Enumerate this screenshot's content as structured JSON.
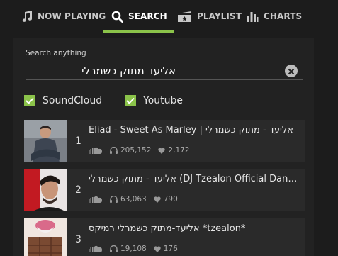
{
  "nav": {
    "tabs": [
      {
        "label": "NOW PLAYING",
        "icon": "music-note-icon"
      },
      {
        "label": "SEARCH",
        "icon": "search-icon",
        "active": true
      },
      {
        "label": "PLAYLIST",
        "icon": "playlist-icon"
      },
      {
        "label": "CHARTS",
        "icon": "bar-chart-icon"
      }
    ]
  },
  "colors": {
    "accent": "#8bc34a",
    "background": "#1c1c1c",
    "panel": "#222222",
    "row": "#2a2a2a"
  },
  "search": {
    "label": "Search anything",
    "value": "אליעד מתוק כשמרלי"
  },
  "sources": [
    {
      "label": "SoundCloud",
      "checked": true
    },
    {
      "label": "Youtube",
      "checked": true
    }
  ],
  "results": [
    {
      "index": "1",
      "title": "Eliad - Sweet As Marley | אליעד - מתוק כשמרלי",
      "plays": "205,152",
      "likes": "2,172"
    },
    {
      "index": "2",
      "title": "אליעד - מתוק כשמרלי (DJ Tzealon Official Dance...",
      "plays": "63,063",
      "likes": "790"
    },
    {
      "index": "3",
      "title": "אליעד-מתוק כשמרלי רמיקס *tzealon*",
      "plays": "19,108",
      "likes": "176"
    }
  ]
}
